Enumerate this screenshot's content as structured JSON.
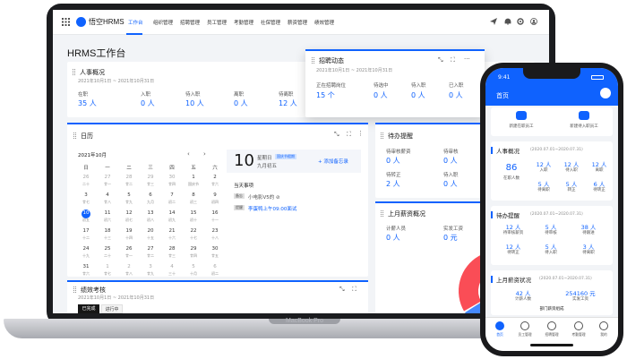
{
  "laptop": {
    "brand": "MacBook Pro",
    "app": {
      "logo_text": "悟空HRMS",
      "nav": [
        "工作台",
        "组织管理",
        "招聘管理",
        "员工管理",
        "考勤管理",
        "社保管理",
        "薪资管理",
        "绩效管理"
      ],
      "active_nav": "工作台",
      "page_title": "HRMS工作台",
      "personnel": {
        "title": "人事概况",
        "date_range": "2021年10月1日 ~ 2021年10月31日",
        "stats": [
          {
            "label": "在职",
            "value": "35 人"
          },
          {
            "label": "入职",
            "value": "0 人"
          },
          {
            "label": "待入职",
            "value": "10 人"
          },
          {
            "label": "离职",
            "value": "0 人"
          },
          {
            "label": "待离职",
            "value": "12 人"
          }
        ]
      },
      "recruit": {
        "title": "招聘动态",
        "date_range": "2021年10月1日 ~ 2021年10月31日",
        "stats": [
          {
            "label": "正在招聘岗位",
            "value": "15 个"
          },
          {
            "label": "待选中",
            "value": "0 人"
          },
          {
            "label": "待入职",
            "value": "0 人"
          },
          {
            "label": "已入职",
            "value": "0 人"
          }
        ]
      },
      "calendar": {
        "title": "日历",
        "month": "2021年10月",
        "weekdays": [
          "日",
          "一",
          "二",
          "三",
          "四",
          "五",
          "六"
        ],
        "weeks": [
          [
            [
              "26",
              "二十"
            ],
            [
              "27",
              "廿一"
            ],
            [
              "28",
              "廿二"
            ],
            [
              "29",
              "廿三"
            ],
            [
              "30",
              "廿四"
            ],
            [
              "1",
              "国庆节"
            ],
            [
              "2",
              "廿六"
            ]
          ],
          [
            [
              "3",
              "廿七"
            ],
            [
              "4",
              "廿八"
            ],
            [
              "5",
              "廿九"
            ],
            [
              "6",
              "九月"
            ],
            [
              "7",
              "初二"
            ],
            [
              "8",
              "初三"
            ],
            [
              "9",
              "初四"
            ]
          ],
          [
            [
              "10",
              "初五"
            ],
            [
              "11",
              "初六"
            ],
            [
              "12",
              "初七"
            ],
            [
              "13",
              "初八"
            ],
            [
              "14",
              "初九"
            ],
            [
              "15",
              "初十"
            ],
            [
              "16",
              "十一"
            ]
          ],
          [
            [
              "17",
              "十二"
            ],
            [
              "18",
              "十三"
            ],
            [
              "19",
              "十四"
            ],
            [
              "20",
              "十五"
            ],
            [
              "21",
              "十六"
            ],
            [
              "22",
              "十七"
            ],
            [
              "23",
              "十八"
            ]
          ],
          [
            [
              "24",
              "十九"
            ],
            [
              "25",
              "二十"
            ],
            [
              "26",
              "廿一"
            ],
            [
              "27",
              "廿二"
            ],
            [
              "28",
              "廿三"
            ],
            [
              "29",
              "廿四"
            ],
            [
              "30",
              "廿五"
            ]
          ],
          [
            [
              "31",
              "廿六"
            ],
            [
              "1",
              "廿七"
            ],
            [
              "2",
              "廿八"
            ],
            [
              "3",
              "廿九"
            ],
            [
              "4",
              "三十"
            ],
            [
              "5",
              "十月"
            ],
            [
              "6",
              "初二"
            ]
          ]
        ],
        "selected_day": "10",
        "big_day": "10",
        "weekday_label": "星期日",
        "lunar_label": "九月初五",
        "tag": "国庆节假期",
        "add_link": "+ 添加备忘录",
        "today_heading": "当天事项",
        "events": [
          {
            "tag": "备忘",
            "text": "小电影V5的 ⊘"
          },
          {
            "tag": "提醒",
            "text": "李蛋鸭上午09:00面试"
          }
        ]
      },
      "todo": {
        "title": "待办提醒",
        "items": [
          {
            "label": "待审核薪资",
            "value": "0 人"
          },
          {
            "label": "待审核",
            "value": "0 人"
          },
          {
            "label": "待转正",
            "value": "2 人"
          },
          {
            "label": "待入职",
            "value": "0 人"
          }
        ]
      },
      "salary": {
        "title": "上月薪资概况",
        "items": [
          {
            "label": "计薪人员",
            "value": "0 人"
          },
          {
            "label": "实发工资",
            "value": "0 元"
          }
        ]
      },
      "performance": {
        "title": "绩效考核",
        "date_range": "2021年10月1日 ~ 2021年10月31日",
        "tabs": [
          "已完成",
          "进行中"
        ]
      }
    }
  },
  "phone": {
    "time": "9:41",
    "title": "首页",
    "actions": [
      "新建在职员工",
      "新建待入职员工"
    ],
    "personnel": {
      "title": "人事概况",
      "range": "(2020.07.01~2020.07.31)",
      "main_value": "86",
      "main_label": "在职人数",
      "stats": [
        {
          "value": "12 人",
          "label": "入职"
        },
        {
          "value": "12 人",
          "label": "待入职"
        },
        {
          "value": "12 人",
          "label": "离职"
        },
        {
          "value": "5 人",
          "label": "待离职"
        },
        {
          "value": "5 人",
          "label": "转正"
        },
        {
          "value": "6 人",
          "label": "待转正"
        }
      ]
    },
    "todo": {
      "title": "待办提醒",
      "range": "(2020.07.01~2020.07.31)",
      "stats": [
        {
          "value": "12 人",
          "label": "待审核薪资"
        },
        {
          "value": "5 人",
          "label": "待审核"
        },
        {
          "value": "38 人",
          "label": "待跟进"
        },
        {
          "value": "12 人",
          "label": "待转正"
        },
        {
          "value": "5 人",
          "label": "待入职"
        },
        {
          "value": "3 人",
          "label": "待离职"
        }
      ]
    },
    "salary": {
      "title": "上月薪资状况",
      "range": "(2020.07.01~2020.07.31)",
      "stats": [
        {
          "value": "42 人",
          "label": "计薪人数"
        },
        {
          "value": "254160 元",
          "label": "实发工资"
        }
      ],
      "sub_title": "部门薪资组成"
    },
    "tabs": [
      "首页",
      "员工管理",
      "招聘管理",
      "考勤管理",
      "我的"
    ]
  },
  "colors": {
    "accent": "#0f62fe",
    "donut": [
      "#fa4d56",
      "#ff832b",
      "#f1c21b",
      "#4589ff"
    ]
  }
}
